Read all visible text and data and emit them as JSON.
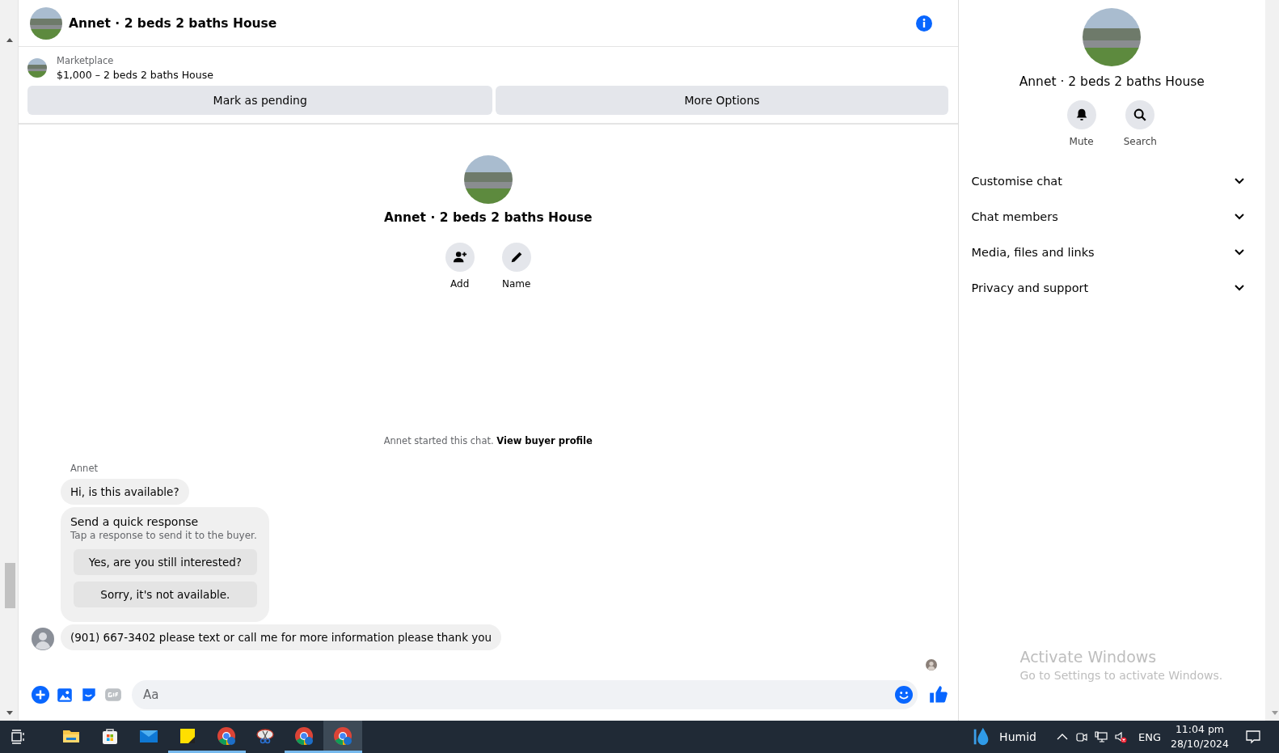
{
  "header": {
    "title": "Annet · 2 beds 2 baths House"
  },
  "listing": {
    "source": "Marketplace",
    "title": "$1,000 – 2 beds 2 baths House",
    "actions": [
      "Mark as pending",
      "More Options"
    ]
  },
  "intro": {
    "title": "Annet · 2 beds 2 baths House",
    "actions": [
      {
        "kind": "add",
        "label": "Add"
      },
      {
        "kind": "name",
        "label": "Name"
      }
    ]
  },
  "notice": {
    "text": "Annet started this chat.",
    "link": "View buyer profile"
  },
  "messages": [
    {
      "kind": "sender",
      "text": "Annet"
    },
    {
      "kind": "bubble",
      "text": "Hi, is this available?",
      "avatar": false
    },
    {
      "kind": "quick",
      "title": "Send a quick response",
      "subtitle": "Tap a response to send it to the buyer.",
      "options": [
        "Yes, are you still interested?",
        "Sorry, it's not available."
      ]
    },
    {
      "kind": "bubble",
      "text": "(901) 667-3402 please text or call me for more information please thank you",
      "avatar": true
    }
  ],
  "composer": {
    "placeholder": "Aa"
  },
  "info_panel": {
    "title": "Annet · 2 beds 2 baths House",
    "actions": [
      {
        "kind": "mute",
        "label": "Mute"
      },
      {
        "kind": "search",
        "label": "Search"
      }
    ],
    "sections": [
      {
        "label": "Customise chat",
        "expanded": false
      },
      {
        "label": "Chat members",
        "expanded": false
      },
      {
        "label": "Media, files and links",
        "expanded": false
      },
      {
        "label": "Privacy and support",
        "expanded": false
      }
    ]
  },
  "activation": {
    "title": "Activate Windows",
    "text": "Go to Settings to activate Windows."
  },
  "taskbar": {
    "apps": [
      {
        "kind": "explorer",
        "running": false,
        "selected": false
      },
      {
        "kind": "store",
        "running": false,
        "selected": false
      },
      {
        "kind": "mail",
        "running": false,
        "selected": false
      },
      {
        "kind": "notes",
        "running": true,
        "selected": false
      },
      {
        "kind": "chrome",
        "running": true,
        "selected": false
      },
      {
        "kind": "snip",
        "running": false,
        "selected": false
      },
      {
        "kind": "chrome",
        "running": true,
        "selected": false
      },
      {
        "kind": "chrome",
        "running": true,
        "selected": true
      }
    ],
    "weather": "Humid",
    "language": "ENG",
    "time": "11:04 pm",
    "date": "28/10/2024"
  }
}
